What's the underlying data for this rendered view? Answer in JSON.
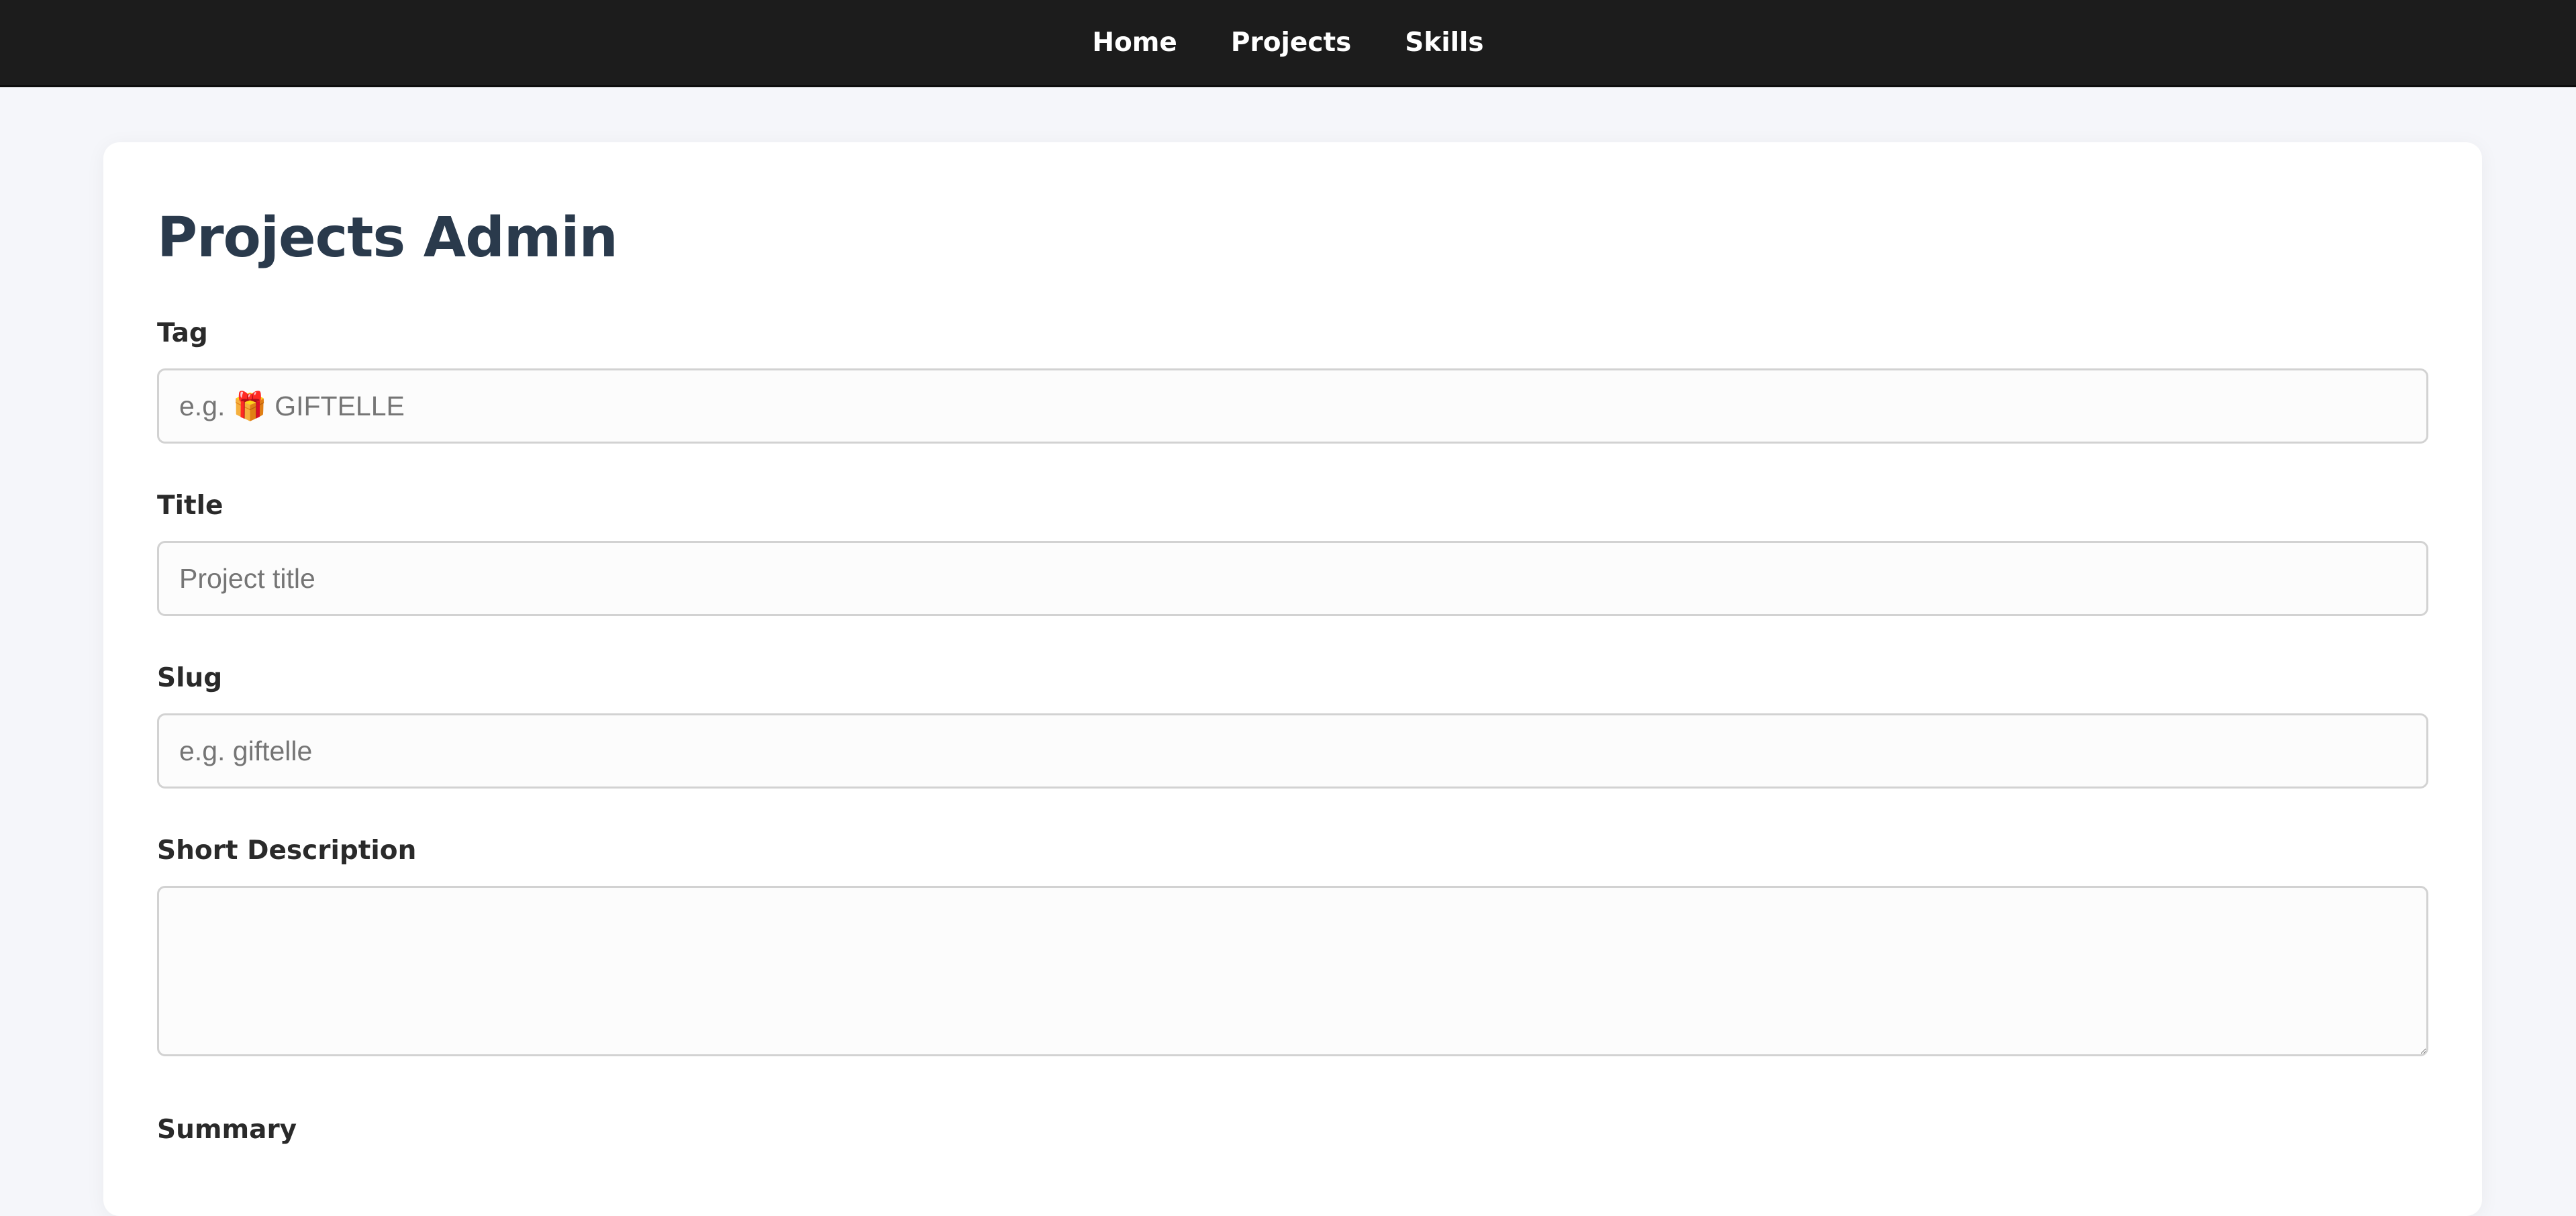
{
  "nav": {
    "items": [
      {
        "label": "Home"
      },
      {
        "label": "Projects"
      },
      {
        "label": "Skills"
      }
    ]
  },
  "main": {
    "title": "Projects Admin",
    "fields": {
      "tag": {
        "label": "Tag",
        "placeholder": "e.g. 🎁 GIFTELLE",
        "value": ""
      },
      "title": {
        "label": "Title",
        "placeholder": "Project title",
        "value": ""
      },
      "slug": {
        "label": "Slug",
        "placeholder": "e.g. giftelle",
        "value": ""
      },
      "short_description": {
        "label": "Short Description",
        "placeholder": "",
        "value": ""
      },
      "summary": {
        "label": "Summary"
      }
    }
  }
}
